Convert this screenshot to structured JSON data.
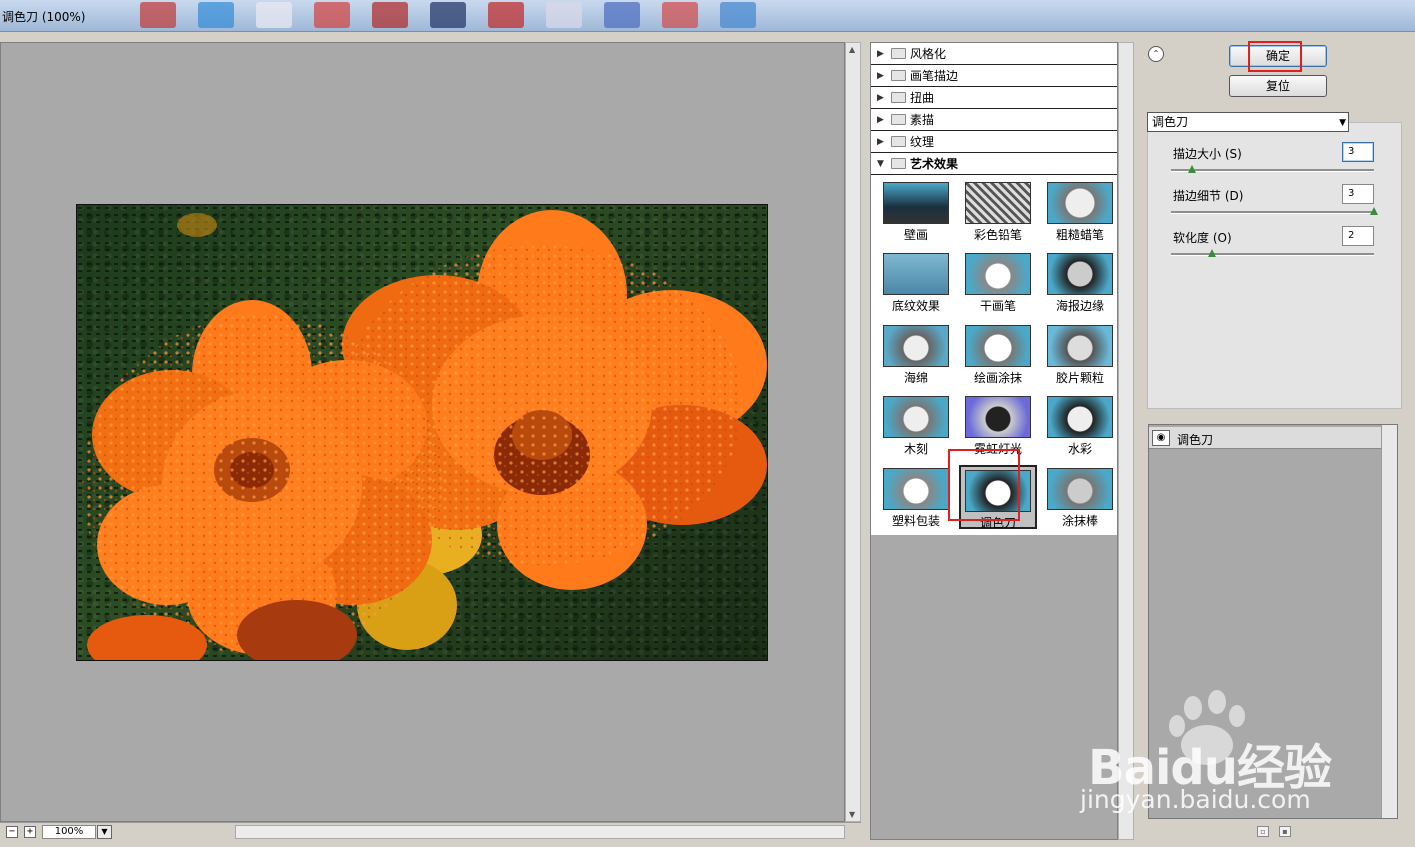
{
  "window": {
    "title": "调色刀 (100%)"
  },
  "status": {
    "zoom": "100%",
    "zoom_out": "−",
    "zoom_in": "+"
  },
  "filter_categories": [
    {
      "label": "风格化",
      "expanded": false
    },
    {
      "label": "画笔描边",
      "expanded": false
    },
    {
      "label": "扭曲",
      "expanded": false
    },
    {
      "label": "素描",
      "expanded": false
    },
    {
      "label": "纹理",
      "expanded": false
    },
    {
      "label": "艺术效果",
      "expanded": true
    }
  ],
  "artistic_filters": [
    "壁画",
    "彩色铅笔",
    "粗糙蜡笔",
    "底纹效果",
    "干画笔",
    "海报边缘",
    "海绵",
    "绘画涂抹",
    "胶片颗粒",
    "木刻",
    "霓虹灯光",
    "水彩",
    "塑料包装",
    "调色刀",
    "涂抹棒"
  ],
  "selected_filter": "调色刀",
  "buttons": {
    "ok": "确定",
    "reset": "复位"
  },
  "filter_select": {
    "value": "调色刀"
  },
  "params": [
    {
      "label": "描边大小 (S)",
      "value": "3",
      "slider_fraction": 0.09
    },
    {
      "label": "描边细节 (D)",
      "value": "3",
      "slider_fraction": 1.0
    },
    {
      "label": "软化度 (O)",
      "value": "2",
      "slider_fraction": 0.2
    }
  ],
  "layers": [
    {
      "name": "调色刀",
      "visible": true
    }
  ],
  "watermark": {
    "brand": "Baidu经验",
    "url": "jingyan.baidu.com"
  },
  "colors": {
    "highlight": "#e02020",
    "panel_gray": "#a9a9a9",
    "flower": "#ff7a1a"
  }
}
